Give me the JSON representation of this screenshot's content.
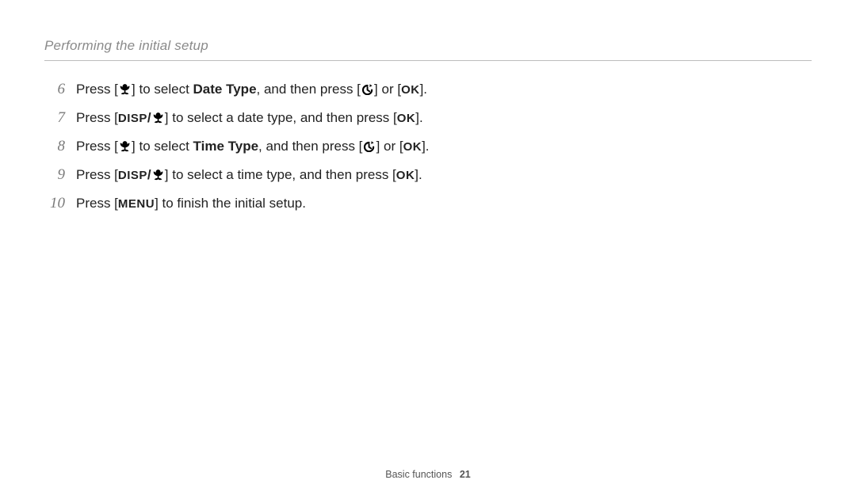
{
  "header": {
    "title": "Performing the initial setup"
  },
  "icons": {
    "macro": "macro-icon",
    "timer": "timer-icon",
    "ok": "OK",
    "disp": "DISP",
    "menu": "MENU"
  },
  "steps": [
    {
      "n": "6",
      "parts": [
        {
          "t": "text",
          "v": "Press ["
        },
        {
          "t": "macro"
        },
        {
          "t": "text",
          "v": "] to select "
        },
        {
          "t": "bold",
          "v": "Date Type"
        },
        {
          "t": "text",
          "v": ", and then press ["
        },
        {
          "t": "timer"
        },
        {
          "t": "text",
          "v": "] or ["
        },
        {
          "t": "ok"
        },
        {
          "t": "text",
          "v": "]."
        }
      ]
    },
    {
      "n": "7",
      "parts": [
        {
          "t": "text",
          "v": "Press ["
        },
        {
          "t": "disp"
        },
        {
          "t": "slash"
        },
        {
          "t": "macro"
        },
        {
          "t": "text",
          "v": "] to select a date type, and then press ["
        },
        {
          "t": "ok"
        },
        {
          "t": "text",
          "v": "]."
        }
      ]
    },
    {
      "n": "8",
      "parts": [
        {
          "t": "text",
          "v": "Press ["
        },
        {
          "t": "macro"
        },
        {
          "t": "text",
          "v": "] to select "
        },
        {
          "t": "bold",
          "v": "Time Type"
        },
        {
          "t": "text",
          "v": ", and then press ["
        },
        {
          "t": "timer"
        },
        {
          "t": "text",
          "v": "] or ["
        },
        {
          "t": "ok"
        },
        {
          "t": "text",
          "v": "]."
        }
      ]
    },
    {
      "n": "9",
      "parts": [
        {
          "t": "text",
          "v": "Press ["
        },
        {
          "t": "disp"
        },
        {
          "t": "slash"
        },
        {
          "t": "macro"
        },
        {
          "t": "text",
          "v": "] to select a time type, and then press ["
        },
        {
          "t": "ok"
        },
        {
          "t": "text",
          "v": "]."
        }
      ]
    },
    {
      "n": "10",
      "parts": [
        {
          "t": "text",
          "v": "Press ["
        },
        {
          "t": "menu"
        },
        {
          "t": "text",
          "v": "] to finish the initial setup."
        }
      ]
    }
  ],
  "footer": {
    "section": "Basic functions",
    "page": "21"
  }
}
